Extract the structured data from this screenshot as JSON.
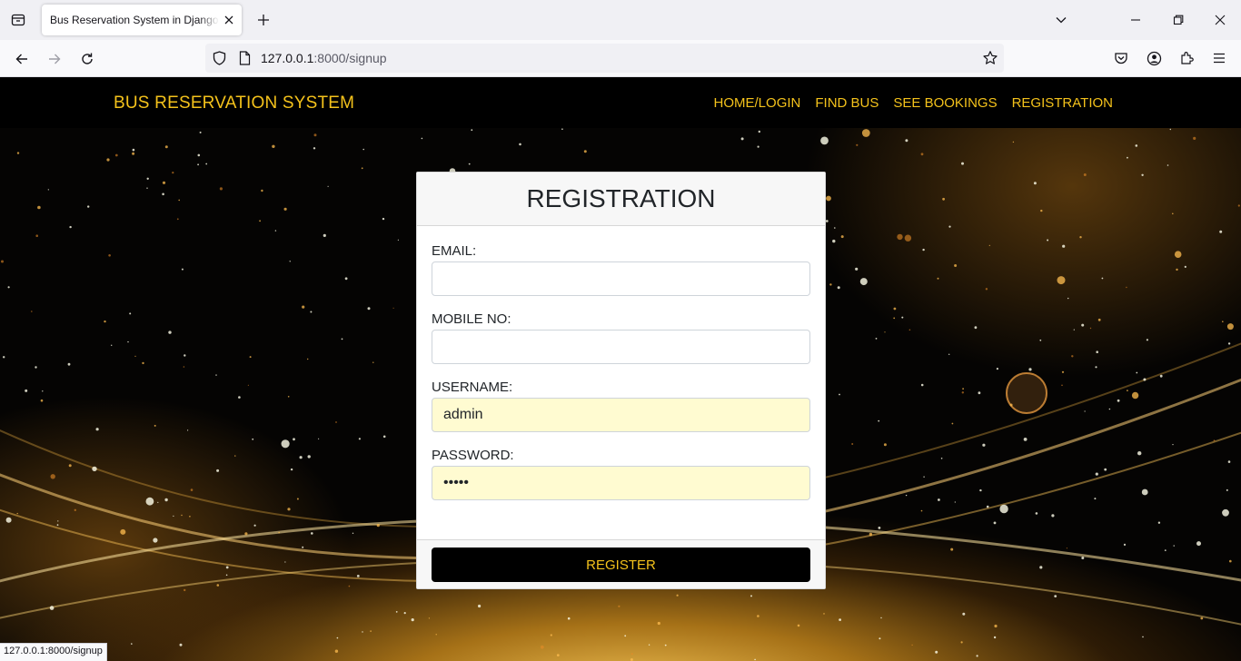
{
  "browser": {
    "tab_title": "Bus Reservation System in Django Framework",
    "url_host": "127.0.0.1",
    "url_path": ":8000/signup",
    "status_url": "127.0.0.1:8000/signup"
  },
  "site": {
    "brand": "BUS RESERVATION SYSTEM",
    "nav": [
      "HOME/LOGIN",
      "FIND BUS",
      "SEE BOOKINGS",
      "REGISTRATION"
    ],
    "accent_color": "#f4c21b"
  },
  "form": {
    "title": "REGISTRATION",
    "email_label": "EMAIL:",
    "email_value": "",
    "mobile_label": "MOBILE NO:",
    "mobile_value": "",
    "username_label": "USERNAME:",
    "username_value": "admin",
    "password_label": "PASSWORD:",
    "password_value": "admin",
    "submit_label": "REGISTER"
  }
}
